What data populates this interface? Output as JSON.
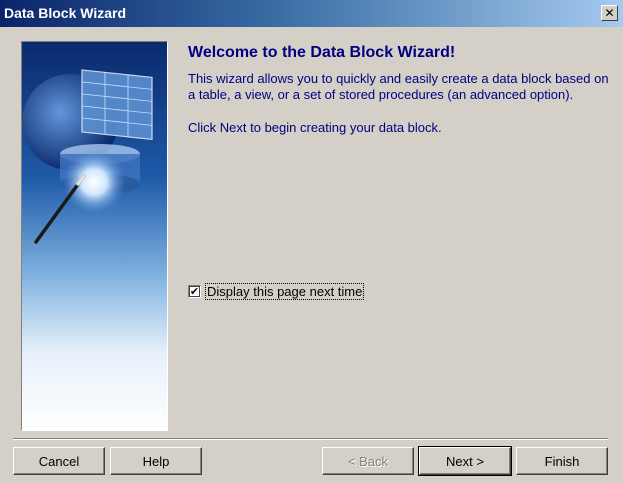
{
  "window": {
    "title": "Data Block Wizard",
    "close_symbol": "✕"
  },
  "content": {
    "heading": "Welcome to the Data Block Wizard!",
    "paragraph1": "This wizard allows you to quickly and easily create a data block based on a table, a view, or a set of stored procedures (an advanced option).",
    "paragraph2": "Click Next to begin creating your data block."
  },
  "checkbox": {
    "label": "Display this page next time",
    "checked": true,
    "check_symbol": "✔"
  },
  "buttons": {
    "cancel": "Cancel",
    "help": "Help",
    "back": "< Back",
    "next": "Next >",
    "finish": "Finish"
  },
  "colors": {
    "dialog_bg": "#d4d0c8",
    "title_bar": "#0a246a",
    "text_accent": "#000080"
  }
}
